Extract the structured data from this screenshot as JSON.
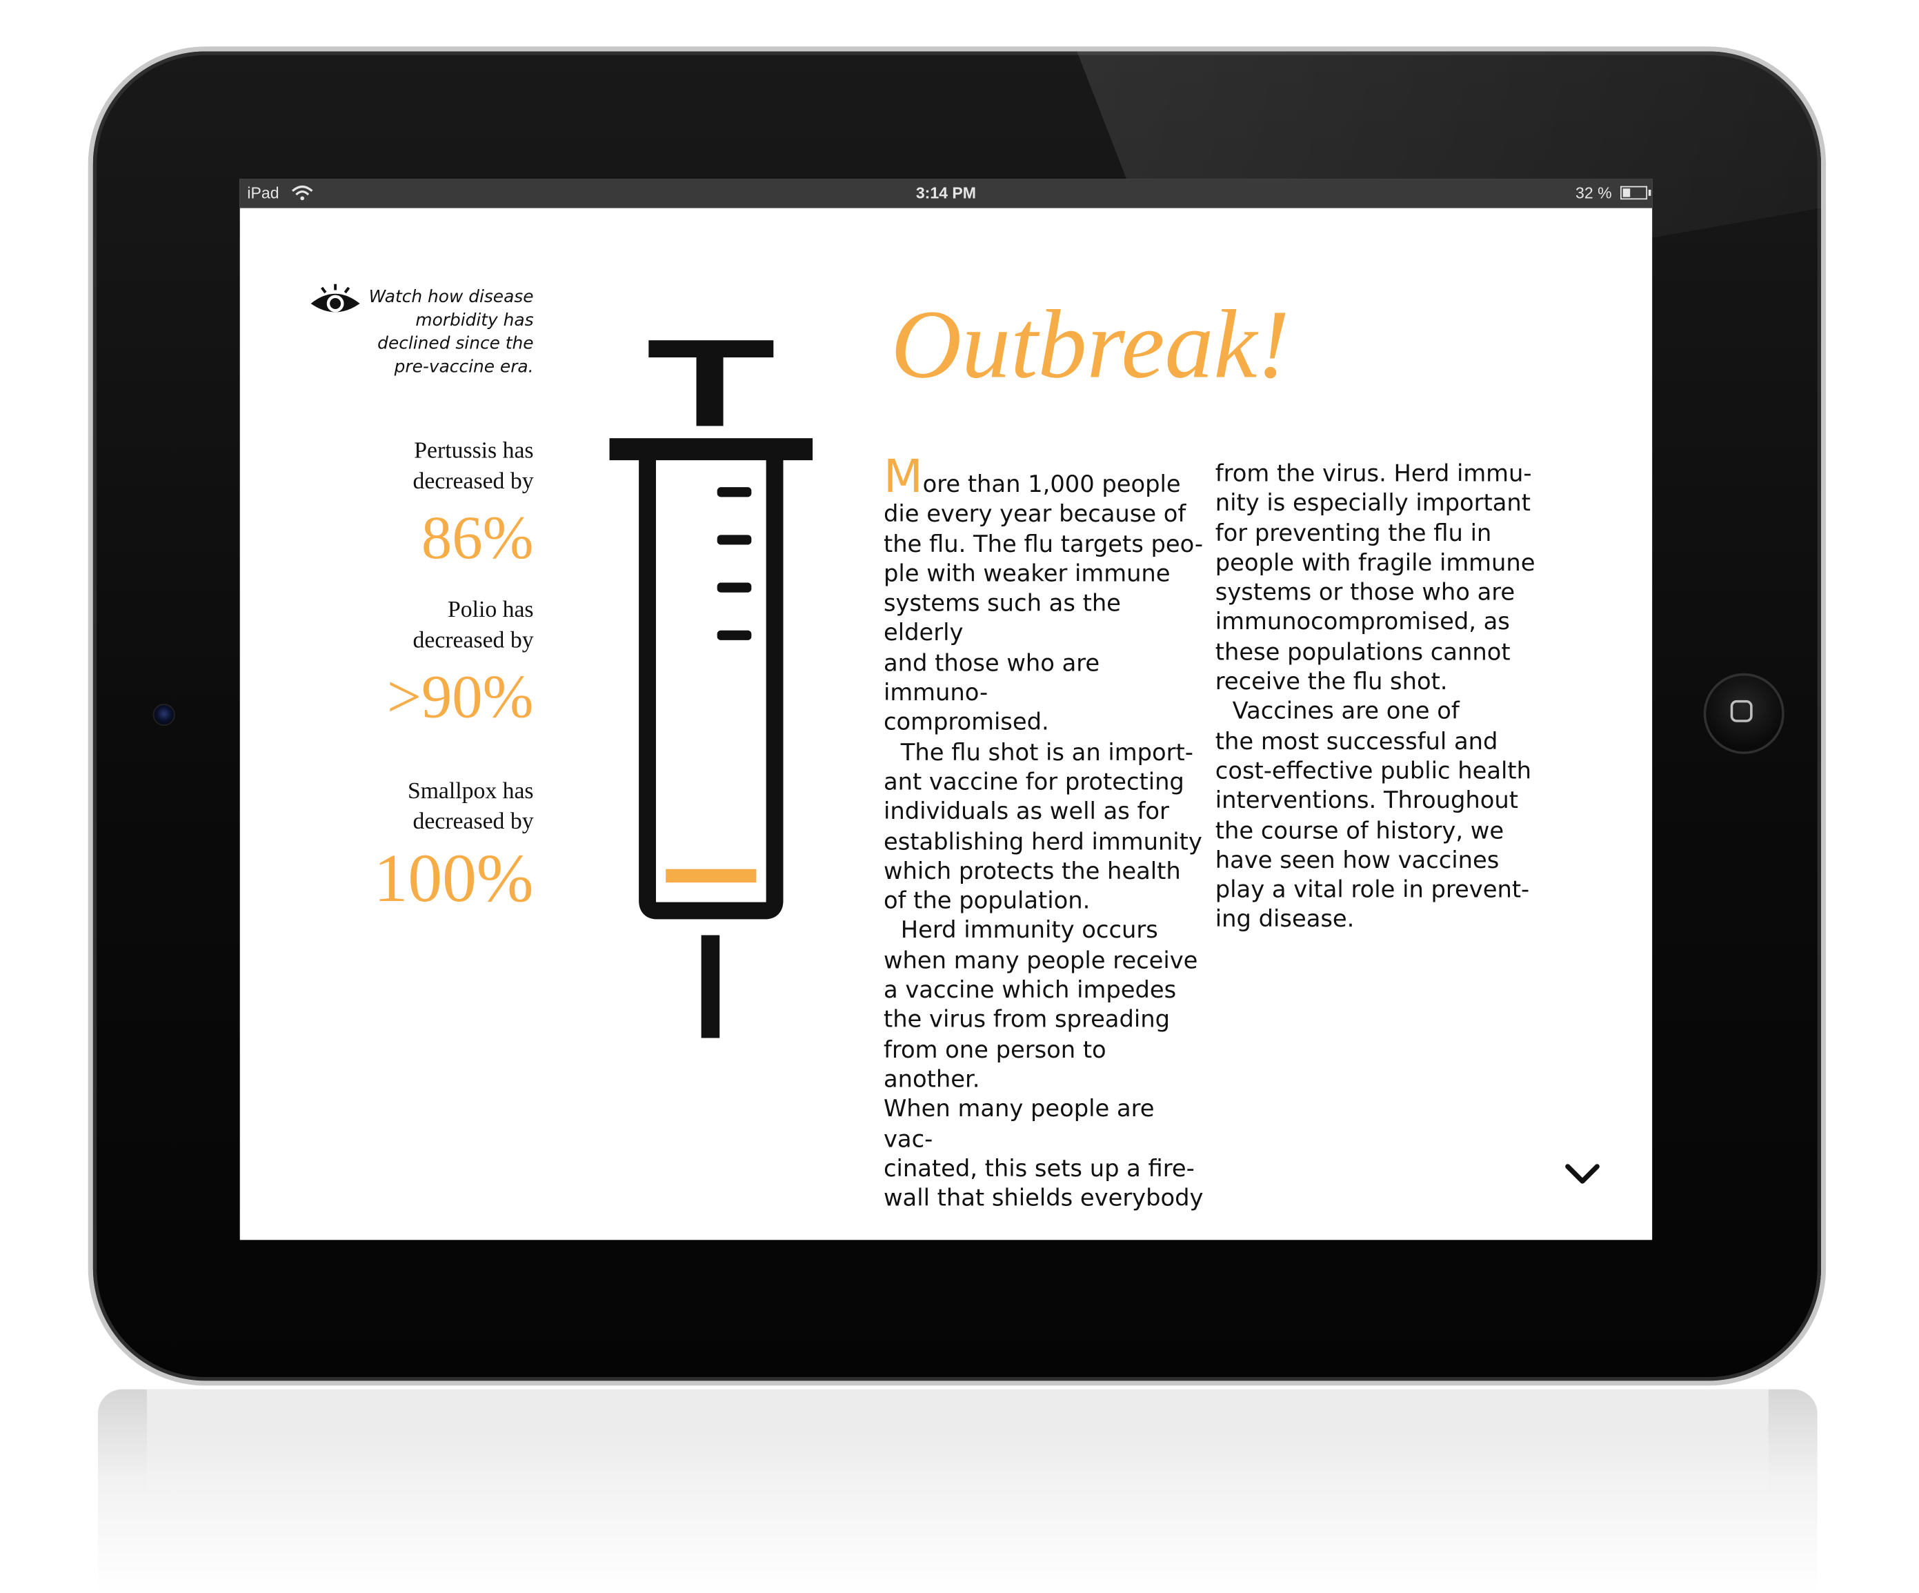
{
  "status_bar": {
    "device": "iPad",
    "time": "3:14 PM",
    "battery_text": "32 %",
    "battery_level": 0.32
  },
  "callout": {
    "icon": "eye-icon",
    "text": "Watch how disease\nmorbidity has\ndeclined since the\npre-vaccine era."
  },
  "stats": [
    {
      "label": "Pertussis has\ndecreased by",
      "value": "86%"
    },
    {
      "label": "Polio has\ndecreased by",
      "value": ">90%"
    },
    {
      "label": "Smallpox has\ndecreased by",
      "value": "100%"
    }
  ],
  "illustration": "syringe-icon",
  "article": {
    "title": "Outbreak!",
    "dropcap": "M",
    "col1_p1": "ore than 1,000 people\ndie every year because of\nthe flu. The flu targets peo-\nple with weaker immune\nsystems such as the elderly\nand those who are immuno-\ncompromised.",
    "col1_p2": "The flu shot is an import-\nant vaccine for protecting\nindividuals as well as for\nestablishing herd immunity\nwhich protects the health\nof the population.",
    "col1_p3": "Herd immunity occurs\nwhen many people receive\na vaccine which impedes\nthe virus from spreading\nfrom one person to another.\nWhen many people are vac-\ncinated, this sets up a fire-\nwall that shields everybody",
    "col2_p1": "from the virus. Herd immu-\nnity is especially important\nfor preventing the flu in\npeople with fragile immune\nsystems or those who are\nimmunocompromised, as\nthese populations cannot\nreceive the flu shot.",
    "col2_p2": "Vaccines are one of\nthe most successful and\ncost-effective public health\ninterventions. Throughout\nthe course of history, we\nhave seen how vaccines\nplay a vital role in prevent-\ning disease."
  },
  "nav": {
    "next_icon": "chevron-down-icon"
  },
  "colors": {
    "accent": "#f6ad48",
    "text": "#111111",
    "status_bar": "#3a3a3a"
  }
}
